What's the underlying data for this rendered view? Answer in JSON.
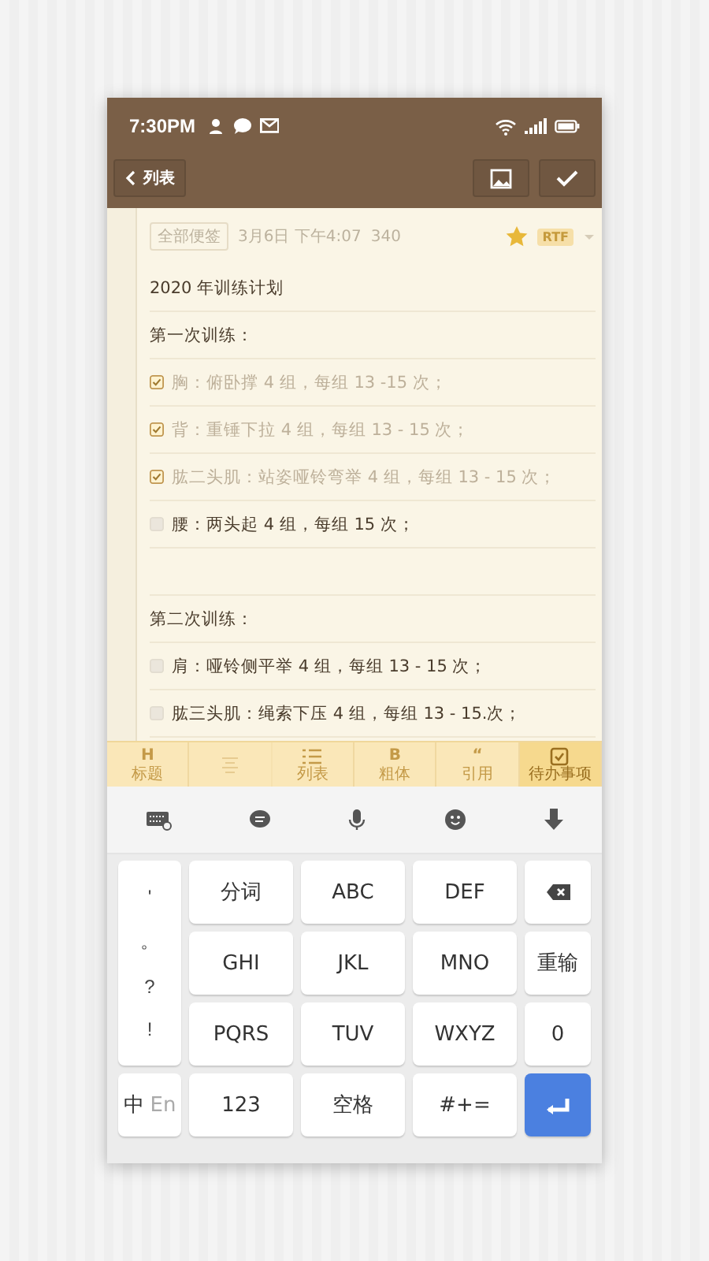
{
  "status_bar": {
    "time": "7:30PM"
  },
  "nav": {
    "back_label": "列表"
  },
  "meta": {
    "folder": "全部便签",
    "date": "3月6日 下午4:07",
    "count": "340",
    "starred": true,
    "format": "RTF"
  },
  "note": [
    {
      "kind": "text",
      "text": "2020 年训练计划"
    },
    {
      "kind": "text",
      "text": "第一次训练："
    },
    {
      "kind": "todo",
      "text": "胸：俯卧撑 4 组，每组 13 -15 次；",
      "checked": true
    },
    {
      "kind": "todo",
      "text": "背：重锤下拉 4 组，每组 13 - 15 次；",
      "checked": true
    },
    {
      "kind": "todo",
      "text": "肱二头肌：站姿哑铃弯举 4 组，每组 13 - 15 次；",
      "checked": true
    },
    {
      "kind": "todo",
      "text": "腰：两头起 4 组，每组 15 次；",
      "checked": false
    },
    {
      "kind": "blank"
    },
    {
      "kind": "text",
      "text": "第二次训练："
    },
    {
      "kind": "todo",
      "text": "肩：哑铃侧平举 4 组，每组 13 - 15 次；",
      "checked": false
    },
    {
      "kind": "todo",
      "text": "肱三头肌：绳索下压 4 组，每组 13 - 15.次；",
      "checked": false
    }
  ],
  "format_toolbar": [
    {
      "kind": "heading",
      "glyph": "H",
      "label": "标题",
      "selected": false,
      "disabled": false
    },
    {
      "kind": "align",
      "selected": false,
      "disabled": true
    },
    {
      "kind": "list",
      "label": "列表",
      "selected": false,
      "disabled": false
    },
    {
      "kind": "bold",
      "glyph": "B",
      "label": "粗体",
      "selected": false,
      "disabled": false
    },
    {
      "kind": "quote",
      "glyph": "“",
      "label": "引用",
      "selected": false,
      "disabled": false
    },
    {
      "kind": "todo",
      "label": "待办事项",
      "selected": true,
      "disabled": false
    }
  ],
  "keyboard": {
    "punctuation": [
      "'",
      "。",
      "?",
      "!"
    ],
    "keys": [
      {
        "kind": "text",
        "label": "分词"
      },
      {
        "kind": "text",
        "label": "ABC"
      },
      {
        "kind": "text",
        "label": "DEF"
      },
      {
        "kind": "backspace"
      },
      {
        "kind": "text",
        "label": "GHI"
      },
      {
        "kind": "text",
        "label": "JKL"
      },
      {
        "kind": "text",
        "label": "MNO"
      },
      {
        "kind": "text",
        "label": "重输"
      },
      {
        "kind": "text",
        "label": "PQRS"
      },
      {
        "kind": "text",
        "label": "TUV"
      },
      {
        "kind": "text",
        "label": "WXYZ"
      },
      {
        "kind": "text",
        "label": "0"
      },
      {
        "kind": "lang",
        "active": "中",
        "inactive": "En"
      },
      {
        "kind": "text",
        "label": "123"
      },
      {
        "kind": "text",
        "label": "空格"
      },
      {
        "kind": "text",
        "label": "#+="
      },
      {
        "kind": "enter"
      }
    ]
  }
}
